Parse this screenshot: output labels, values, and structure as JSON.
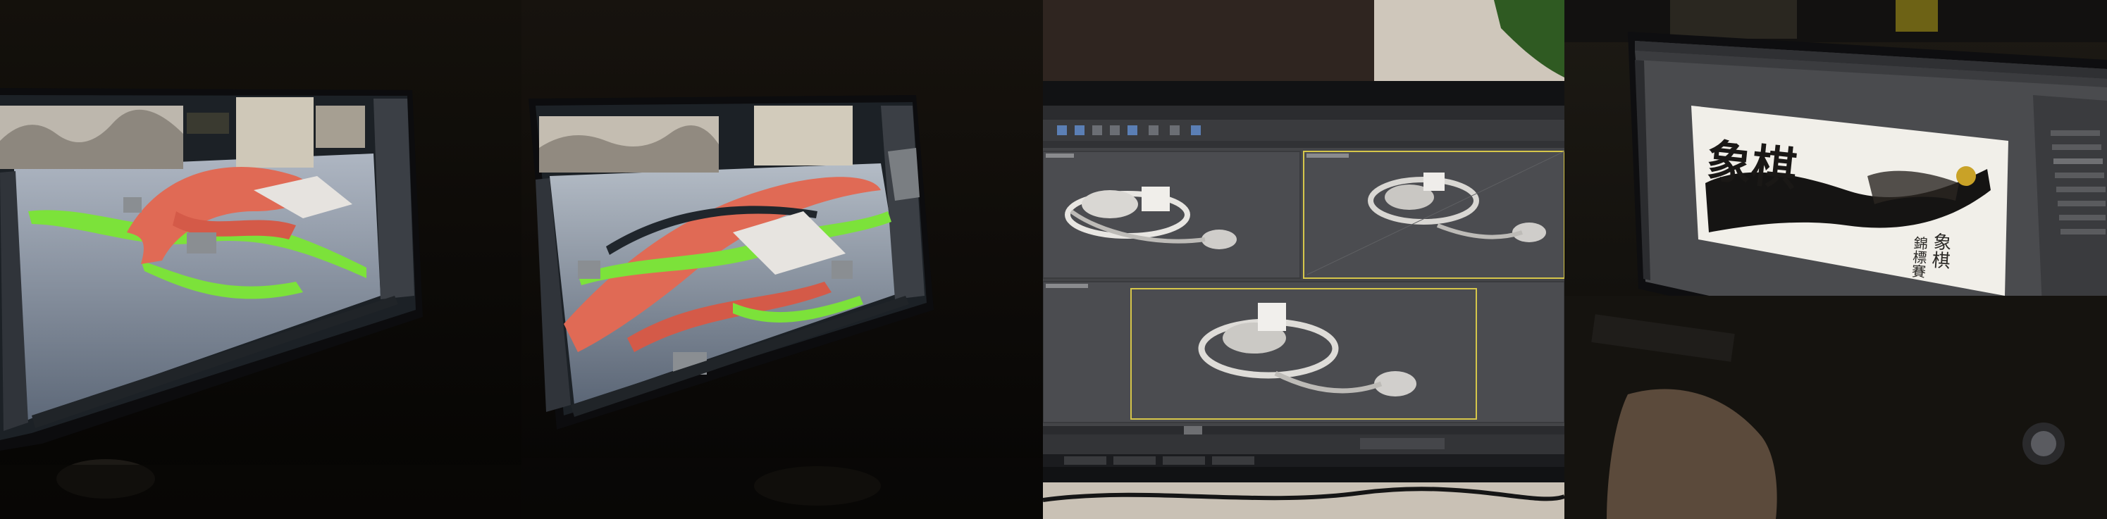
{
  "photos": {
    "first": {
      "label": ""
    },
    "second": {
      "label": ""
    },
    "third": {
      "label": ""
    },
    "fourth": {
      "artwork_big_glyphs": "象棋",
      "artwork_title_line1": "象棋",
      "artwork_title_line2": "錦標賽"
    }
  }
}
